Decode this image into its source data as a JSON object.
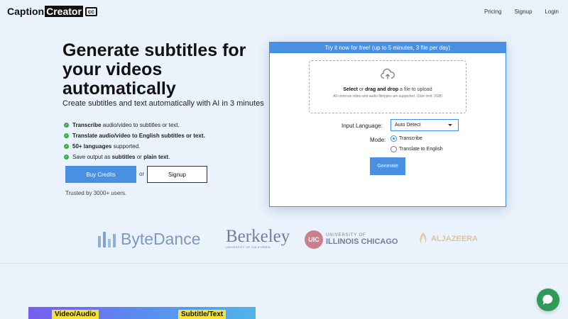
{
  "header": {
    "logo_part1": "Caption",
    "logo_part2": "Creator",
    "logo_badge": "cc",
    "nav": [
      "Pricing",
      "Signup",
      "Login"
    ]
  },
  "hero": {
    "title": "Generate subtitles for your videos automatically",
    "subtitle": "Create subtitles and text automatically with AI in 3 minutes",
    "features": [
      {
        "bold": "Transcribe",
        "rest": " audio/video to subtitles or text."
      },
      {
        "bold": "Translate",
        "rest": " audio/video to English subtitles or text."
      },
      {
        "bold": "50+ languages",
        "rest": " supported."
      },
      {
        "pre": "Save output as ",
        "bold": "subtitles",
        "mid": " or ",
        "bold2": "plain text",
        "post": "."
      }
    ],
    "buy_label": "Buy Credits",
    "or_label": "or",
    "signup_label": "Signup",
    "trusted": "Trusted by 3000+ users."
  },
  "card": {
    "header": "Try it now for free! (up to 5 minutes, 3 file per day)",
    "drop_select": "Select",
    "drop_or": " or ",
    "drop_drag": "drag and drop",
    "drop_rest": " a file to upload",
    "drop_note": "All common video and audio filetypes are supported. (Size limit: 2GB)",
    "input_language_label": "Input Language:",
    "input_language_value": "Auto Detect",
    "mode_label": "Mode:",
    "modes": [
      {
        "label": "Transcribe",
        "selected": true
      },
      {
        "label": "Translate to English",
        "selected": false
      }
    ],
    "generate_label": "Generate"
  },
  "logos": {
    "bytedance": "ByteDance",
    "berkeley": "Berkeley",
    "berkeley_sub": "UNIVERSITY OF CALIFORNIA",
    "uic_badge": "UIC",
    "uic_top": "UNIVERSITY OF",
    "uic_bottom": "ILLINOIS CHICAGO",
    "aljazeera": "ALJAZEERA"
  },
  "bottom": {
    "tag1": "Video/Audio",
    "tag2": "Subtitle/Text"
  },
  "colors": {
    "accent": "#4a90e2",
    "check": "#2fb04a",
    "chat": "#2f9a55",
    "page_bg": "#eaf3fc"
  }
}
